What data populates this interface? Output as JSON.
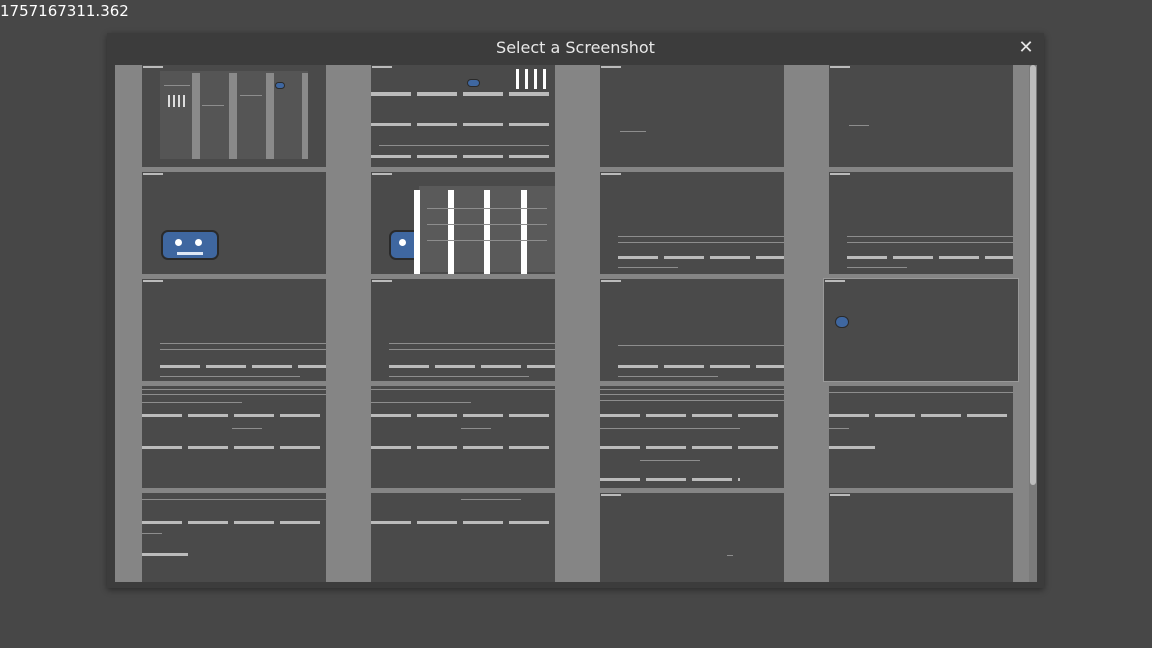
{
  "timestamp": "1757167311.362",
  "dialog": {
    "title": "Select a Screenshot",
    "close_icon": "close-icon"
  },
  "colors": {
    "background": "#474747",
    "dialog": "#3c3c3c",
    "grid_gap": "#858585",
    "thumbnail": "#4a4a4a",
    "godot_blue": "#3f67a0"
  },
  "thumbnails_count": 20
}
